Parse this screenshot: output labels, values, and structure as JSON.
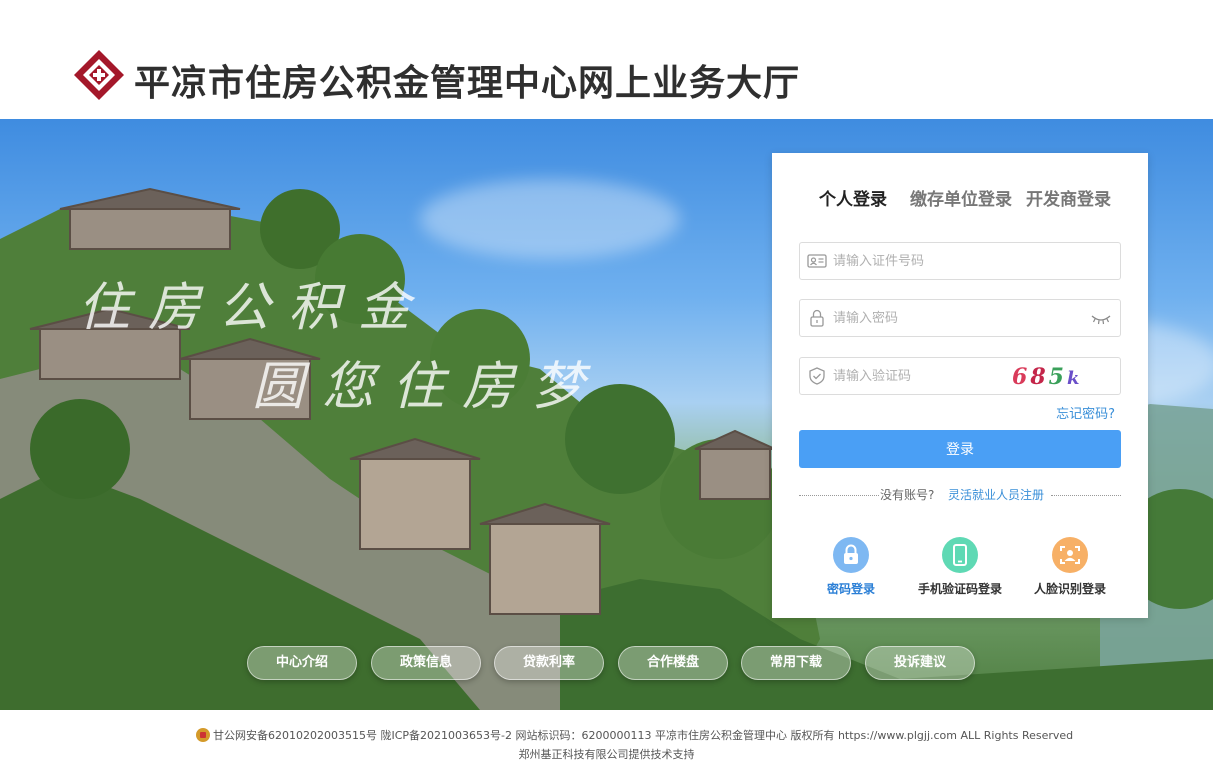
{
  "header": {
    "site_title": "平凉市住房公积金管理中心网上业务大厅"
  },
  "hero": {
    "calligraphy_line1": "住房公积金",
    "calligraphy_line2": "圆您住房梦"
  },
  "login": {
    "tabs": [
      {
        "label": "个人登录",
        "active": true
      },
      {
        "label": "缴存单位登录",
        "active": false
      },
      {
        "label": "开发商登录",
        "active": false
      }
    ],
    "id_placeholder": "请输入证件号码",
    "password_placeholder": "请输入密码",
    "captcha_placeholder": "请输入验证码",
    "captcha_chars": [
      "6",
      "8",
      "5",
      "k"
    ],
    "forgot_label": "忘记密码?",
    "submit_label": "登录",
    "no_account_label": "没有账号?",
    "register_label": "灵活就业人员注册",
    "methods": [
      {
        "label": "密码登录",
        "icon": "lock-icon"
      },
      {
        "label": "手机验证码登录",
        "icon": "phone-icon"
      },
      {
        "label": "人脸识别登录",
        "icon": "face-scan-icon"
      }
    ]
  },
  "nav": {
    "items": [
      "中心介绍",
      "政策信息",
      "贷款利率",
      "合作楼盘",
      "常用下载",
      "投诉建议"
    ]
  },
  "footer": {
    "line1": "甘公网安备62010202003515号  陇ICP备2021003653号-2  网站标识码：6200000113  平凉市住房公积金管理中心  版权所有  https://www.plgjj.com  ALL Rights Reserved",
    "line2": "郑州基正科技有限公司提供技术支持"
  },
  "colors": {
    "brand_red": "#a4182a",
    "primary_blue": "#4a9ff5",
    "link_blue": "#3a8fd8"
  }
}
